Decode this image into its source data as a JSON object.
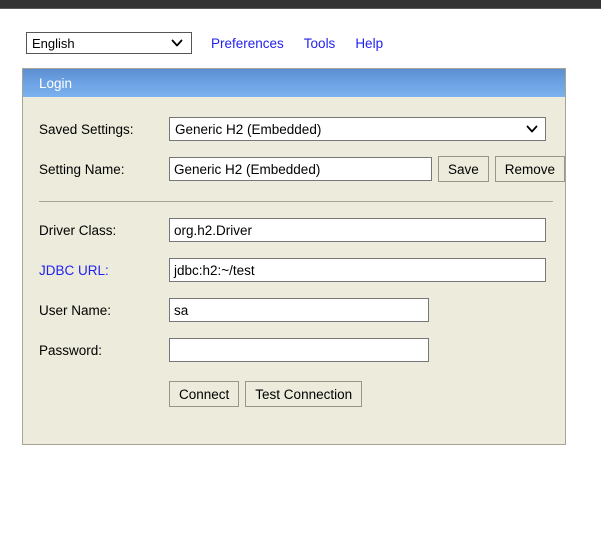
{
  "toolbar": {
    "language_select": {
      "value": "English",
      "icon": "chevron-down-icon"
    },
    "links": [
      {
        "label": "Preferences"
      },
      {
        "label": "Tools"
      },
      {
        "label": "Help"
      }
    ]
  },
  "panel": {
    "title": "Login",
    "rows": {
      "saved_settings": {
        "label": "Saved Settings:",
        "value": "Generic H2 (Embedded)",
        "icon": "chevron-down-icon"
      },
      "setting_name": {
        "label": "Setting Name:",
        "value": "Generic H2 (Embedded)",
        "placeholder": "",
        "save_label": "Save",
        "remove_label": "Remove"
      },
      "driver_class": {
        "label": "Driver Class:",
        "value": "org.h2.Driver",
        "placeholder": ""
      },
      "jdbc_url": {
        "label": "JDBC URL:",
        "value": "jdbc:h2:~/test",
        "placeholder": ""
      },
      "user_name": {
        "label": "User Name:",
        "value": "sa",
        "placeholder": ""
      },
      "password": {
        "label": "Password:",
        "value": "",
        "placeholder": ""
      }
    },
    "actions": {
      "connect_label": "Connect",
      "test_connection_label": "Test Connection"
    }
  },
  "colors": {
    "top_strip": "#333333",
    "panel_bg": "#ecebdc",
    "panel_border": "#a9a396",
    "header_blue_top": "#5b8fd0",
    "header_blue_bottom": "#7db2f0",
    "link_blue": "#2222ee",
    "field_bg": "#ffffff"
  }
}
